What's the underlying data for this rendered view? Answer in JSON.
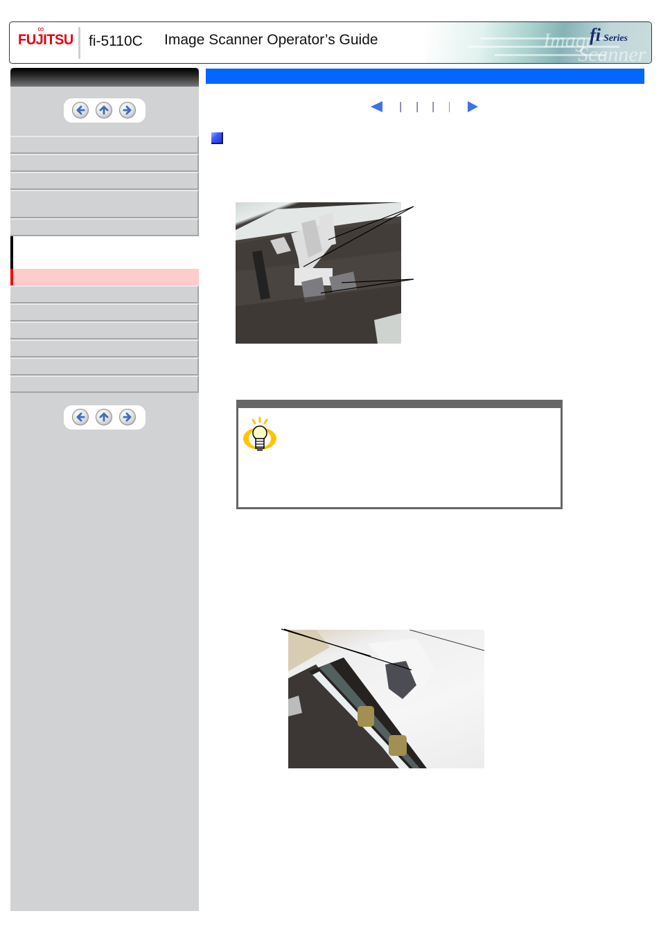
{
  "header": {
    "brand": "FUJITSU",
    "model": "fi-5110C",
    "title": "Image Scanner Operator’s Guide",
    "series_mark": "fi",
    "series_word": "Series",
    "art_words": [
      "Image",
      "Scanner"
    ]
  },
  "sidebar": {
    "top_nav": {
      "buttons": [
        {
          "name": "back",
          "icon": "arrow-left-icon"
        },
        {
          "name": "up",
          "icon": "arrow-up-icon"
        },
        {
          "name": "forward",
          "icon": "arrow-right-icon"
        }
      ]
    },
    "items": [
      {
        "label": "",
        "state": "normal"
      },
      {
        "label": "",
        "state": "normal"
      },
      {
        "label": "",
        "state": "normal"
      },
      {
        "label": "",
        "state": "normal"
      },
      {
        "label": "",
        "state": "normal"
      },
      {
        "label": "",
        "state": "current"
      },
      {
        "label": "",
        "state": "active"
      },
      {
        "label": "",
        "state": "normal"
      },
      {
        "label": "",
        "state": "normal"
      },
      {
        "label": "",
        "state": "normal"
      },
      {
        "label": "",
        "state": "normal"
      },
      {
        "label": "",
        "state": "normal"
      },
      {
        "label": "",
        "state": "normal"
      }
    ],
    "bottom_nav": {
      "buttons": [
        {
          "name": "back",
          "icon": "arrow-left-icon"
        },
        {
          "name": "up",
          "icon": "arrow-up-icon"
        },
        {
          "name": "forward",
          "icon": "arrow-right-icon"
        }
      ]
    }
  },
  "main": {
    "title": "",
    "page_nav": {
      "prev_icon": "triangle-left-icon",
      "next_icon": "triangle-right-icon",
      "page_count": 4
    },
    "section_heading": "",
    "figures": [
      {
        "name": "pad-assy-photo",
        "caption": "",
        "callouts": 2
      },
      {
        "name": "pick-roller-photo",
        "caption": "",
        "callouts": 1
      }
    ],
    "hint": {
      "heading": "",
      "icon": "lightbulb-icon",
      "body": ""
    }
  },
  "colors": {
    "brand_red": "#e60012",
    "title_bar_blue": "#0066ff",
    "sidebar_bg": "#d1d2d4",
    "active_item_bg": "#ffcccc",
    "active_item_marker": "#ff0000",
    "nav_arrow_blue": "#3a73e8",
    "hint_border": "#666666"
  }
}
